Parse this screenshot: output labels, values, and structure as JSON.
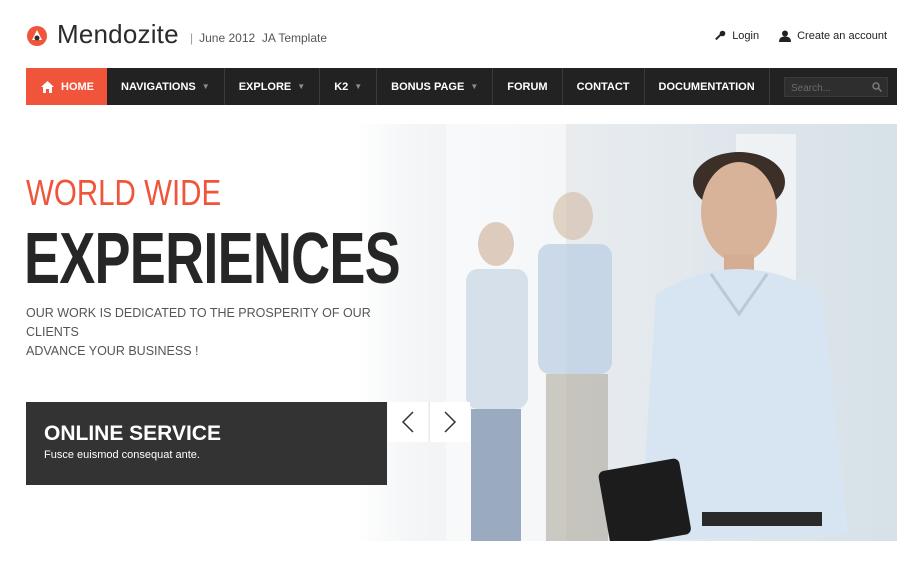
{
  "brand": {
    "name": "Mendozite",
    "tagline_date": "June 2012",
    "tagline_text": "JA Template",
    "accent": "#f0553b"
  },
  "top_links": {
    "login": "Login",
    "create_account": "Create an account"
  },
  "nav": {
    "items": [
      {
        "label": "HOME",
        "caret": false,
        "active": true
      },
      {
        "label": "NAVIGATIONS",
        "caret": true
      },
      {
        "label": "EXPLORE",
        "caret": true
      },
      {
        "label": "K2",
        "caret": true
      },
      {
        "label": "BONUS PAGE",
        "caret": true
      },
      {
        "label": "FORUM",
        "caret": false
      },
      {
        "label": "CONTACT",
        "caret": false
      },
      {
        "label": "DOCUMENTATION",
        "caret": false
      }
    ],
    "search_placeholder": "Search..."
  },
  "hero": {
    "title_line1": "WORLD WIDE",
    "title_line2": "EXPERIENCES",
    "subtitle_line1": "OUR WORK IS DEDICATED TO THE PROSPERITY OF OUR CLIENTS",
    "subtitle_line2": "ADVANCE YOUR BUSINESS !",
    "service_title": "ONLINE SERVICE",
    "service_text": "Fusce euismod consequat ante."
  }
}
